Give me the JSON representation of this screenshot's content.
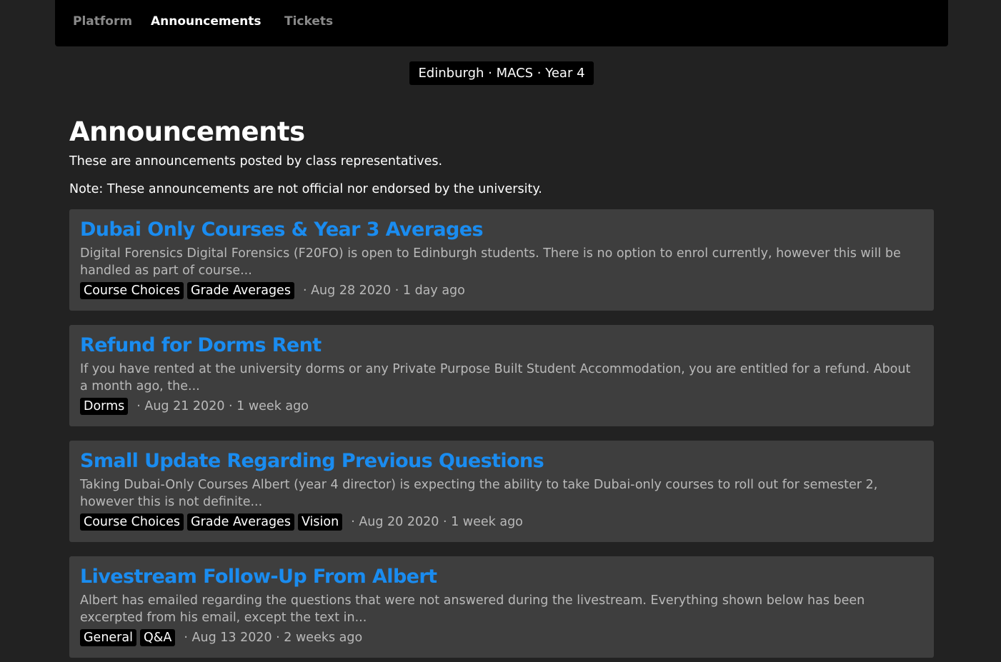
{
  "nav": {
    "items": [
      {
        "label": "Platform",
        "active": false
      },
      {
        "label": "Announcements",
        "active": true
      },
      {
        "label": "Tickets",
        "active": false
      }
    ]
  },
  "context": {
    "label": "Edinburgh · MACS · Year 4"
  },
  "page": {
    "title": "Announcements",
    "description": "These are announcements posted by class representatives.",
    "note": "Note: These announcements are not official nor endorsed by the university."
  },
  "announcements": [
    {
      "title": "Dubai Only Courses & Year 3 Averages",
      "excerpt": "Digital Forensics Digital Forensics (F20FO) is open to Edinburgh students. There is no option to enrol currently, however this will be handled as part of course...",
      "tags": [
        "Course Choices",
        "Grade Averages"
      ],
      "meta": "· Aug 28 2020 · 1 day ago"
    },
    {
      "title": "Refund for Dorms Rent",
      "excerpt": "If you have rented at the university dorms or any Private Purpose Built Student Accommodation, you are entitled for a refund. About a month ago, the...",
      "tags": [
        "Dorms"
      ],
      "meta": "· Aug 21 2020 · 1 week ago"
    },
    {
      "title": "Small Update Regarding Previous Questions",
      "excerpt": "Taking Dubai-Only Courses Albert (year 4 director) is expecting the ability to take Dubai-only courses to roll out for semester 2, however this is not definite...",
      "tags": [
        "Course Choices",
        "Grade Averages",
        "Vision"
      ],
      "meta": "· Aug 20 2020 · 1 week ago"
    },
    {
      "title": "Livestream Follow-Up From Albert",
      "excerpt": "Albert has emailed regarding the questions that were not answered during the livestream. Everything shown below has been excerpted from his email, except the text in...",
      "tags": [
        "General",
        "Q&A"
      ],
      "meta": "· Aug 13 2020 · 2 weeks ago"
    }
  ],
  "colors": {
    "background": "#222222",
    "card": "#3e3e3e",
    "link": "#1a8cf0",
    "muted": "#b9b9b9",
    "nav_inactive": "#8a8a8a"
  }
}
